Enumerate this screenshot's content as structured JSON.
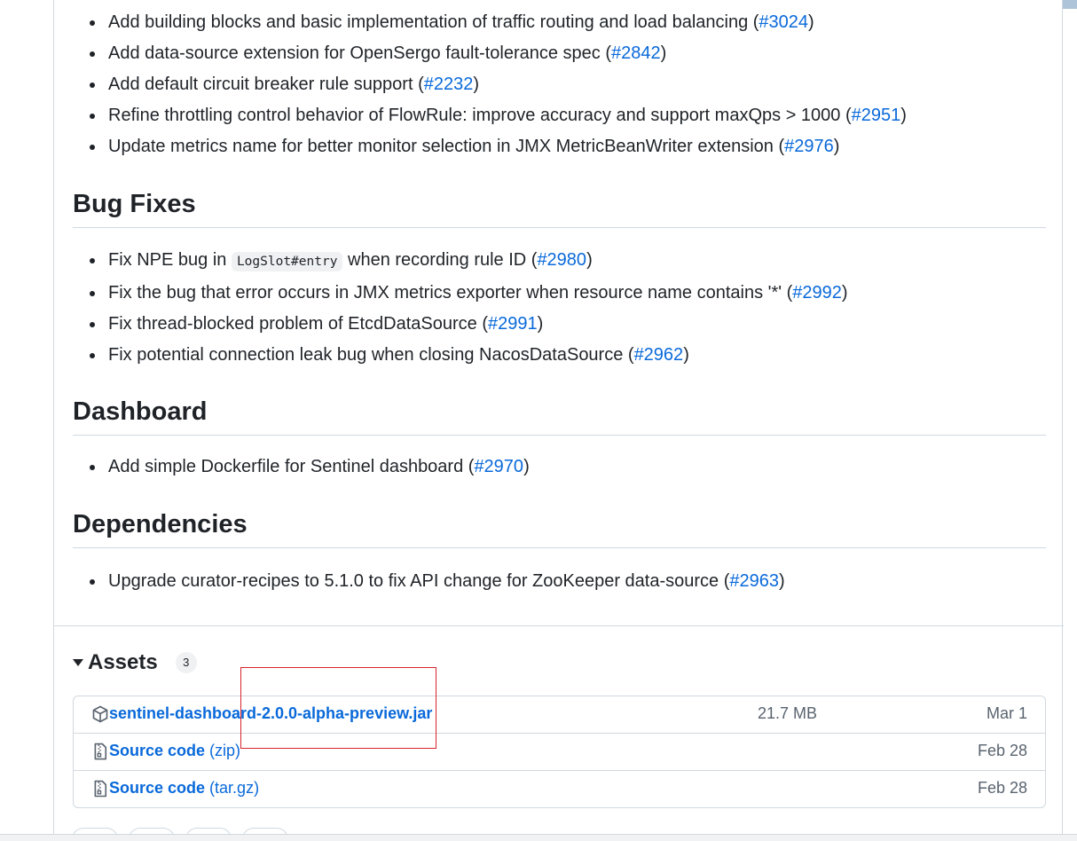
{
  "features": {
    "items": [
      {
        "text": "Add building blocks and basic implementation of traffic routing and load balancing (",
        "pr": "#3024",
        "tail": ")"
      },
      {
        "text": "Add data-source extension for OpenSergo fault-tolerance spec (",
        "pr": "#2842",
        "tail": ")"
      },
      {
        "text": "Add default circuit breaker rule support (",
        "pr": "#2232",
        "tail": ")"
      },
      {
        "text": "Refine throttling control behavior of FlowRule: improve accuracy and support maxQps > 1000 (",
        "pr": "#2951",
        "tail": ")"
      },
      {
        "text": "Update metrics name for better monitor selection in JMX MetricBeanWriter extension (",
        "pr": "#2976",
        "tail": ")"
      }
    ]
  },
  "bug_fixes": {
    "heading": "Bug Fixes",
    "item0_pre": "Fix NPE bug in ",
    "item0_code": "LogSlot#entry",
    "item0_post": " when recording rule ID (",
    "item0_pr": "#2980",
    "item0_tail": ")",
    "items": [
      {
        "text": "Fix the bug that error occurs in JMX metrics exporter when resource name contains '*' (",
        "pr": "#2992",
        "tail": ")"
      },
      {
        "text": "Fix thread-blocked problem of EtcdDataSource (",
        "pr": "#2991",
        "tail": ")"
      },
      {
        "text": "Fix potential connection leak bug when closing NacosDataSource (",
        "pr": "#2962",
        "tail": ")"
      }
    ]
  },
  "dashboard": {
    "heading": "Dashboard",
    "items": [
      {
        "text": "Add simple Dockerfile for Sentinel dashboard (",
        "pr": "#2970",
        "tail": ")"
      }
    ]
  },
  "dependencies": {
    "heading": "Dependencies",
    "items": [
      {
        "text": "Upgrade curator-recipes to 5.1.0 to fix API change for ZooKeeper data-source (",
        "pr": "#2963",
        "tail": ")"
      }
    ]
  },
  "assets": {
    "title": "Assets",
    "count": "3",
    "rows": [
      {
        "icon": "package-icon",
        "name": "sentinel-dashboard-2.0.0-alpha-preview.jar",
        "format": "",
        "size": "21.7 MB",
        "date": "Mar 1"
      },
      {
        "icon": "file-zip-icon",
        "name": "Source code",
        "format": " (zip)",
        "size": "",
        "date": "Feb 28"
      },
      {
        "icon": "file-zip-icon",
        "name": "Source code",
        "format": " (tar.gz)",
        "size": "",
        "date": "Feb 28"
      }
    ]
  },
  "colors": {
    "link": "#0969da",
    "text": "#1f2328",
    "muted": "#59636e",
    "border": "#d1d9e0",
    "highlight": "#d6232a"
  }
}
